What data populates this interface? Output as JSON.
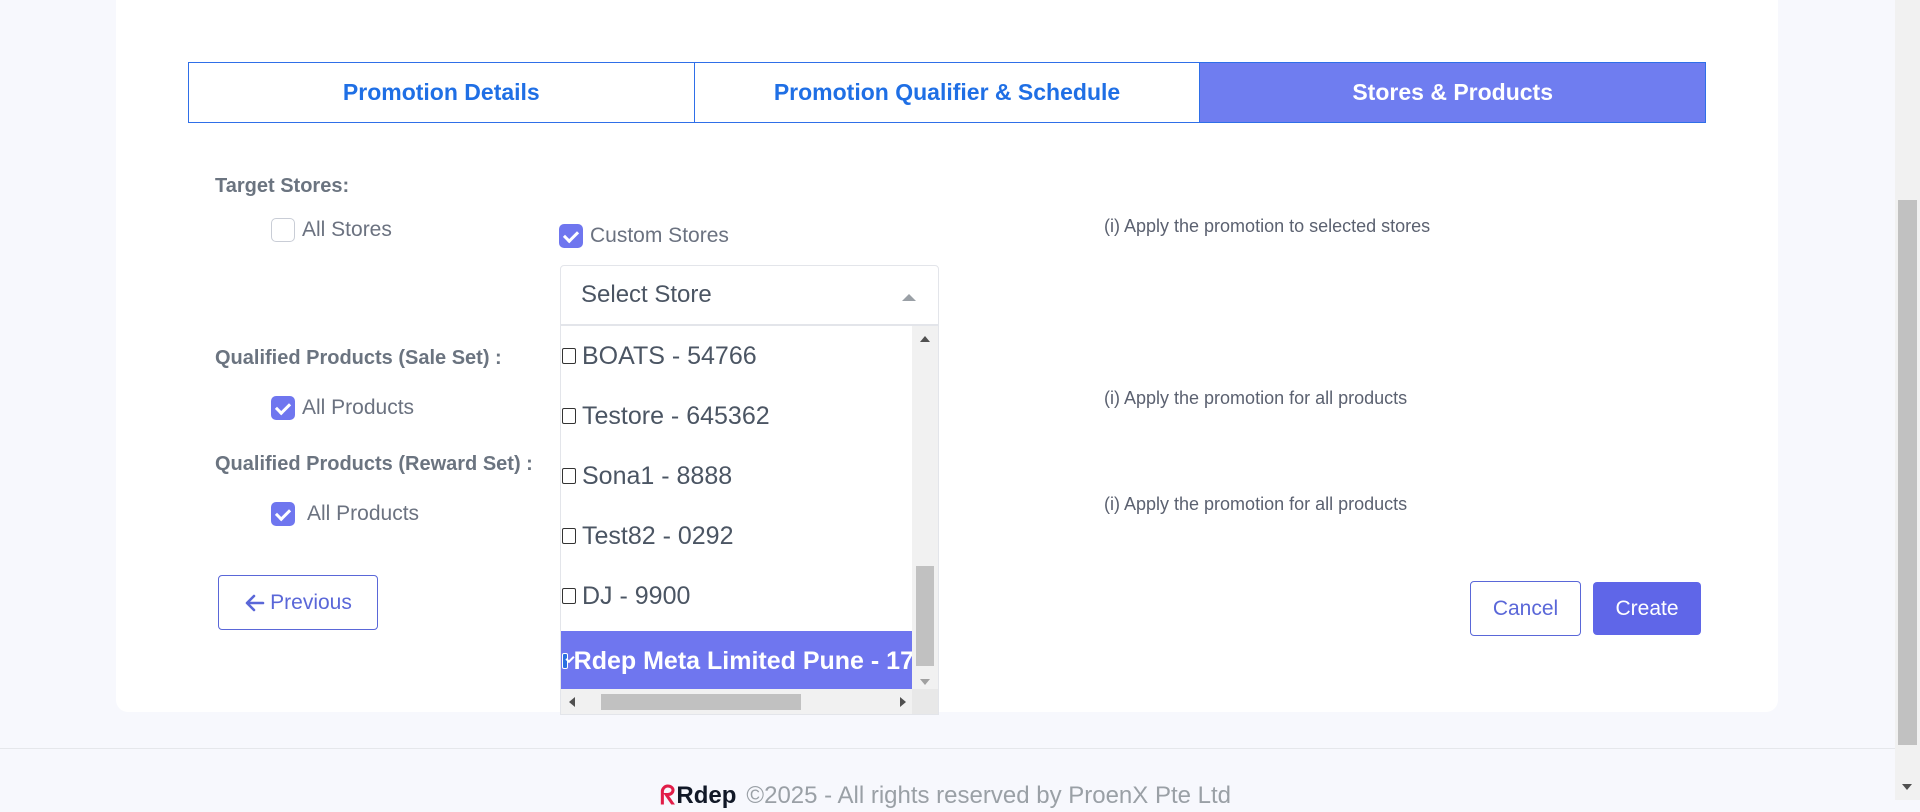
{
  "tabs": [
    {
      "label": "Promotion Details",
      "active": false
    },
    {
      "label": "Promotion Qualifier & Schedule",
      "active": false
    },
    {
      "label": "Stores & Products",
      "active": true
    }
  ],
  "target_stores": {
    "label": "Target Stores:",
    "all_stores": {
      "label": "All Stores",
      "checked": false
    },
    "custom_stores": {
      "label": "Custom Stores",
      "checked": true
    },
    "hint": "(i) Apply the promotion to selected stores"
  },
  "store_select": {
    "placeholder": "Select Store",
    "options": [
      {
        "label": "BOATS - 54766",
        "checked": false
      },
      {
        "label": "Testore - 645362",
        "checked": false
      },
      {
        "label": "Sona1 - 8888",
        "checked": false
      },
      {
        "label": "Test82 - 0292",
        "checked": false
      },
      {
        "label": "DJ - 9900",
        "checked": false
      },
      {
        "label": "Rdep Meta Limited Pune - 17",
        "checked": true
      }
    ]
  },
  "sale_set": {
    "label": "Qualified Products (Sale Set) :",
    "all_products": {
      "label": "All Products",
      "checked": true
    },
    "hint": "(i) Apply the promotion for all products"
  },
  "reward_set": {
    "label": "Qualified Products (Reward Set) :",
    "all_products": {
      "label": "All Products",
      "checked": true
    },
    "hint": "(i) Apply the promotion for all products"
  },
  "buttons": {
    "previous": "Previous",
    "cancel": "Cancel",
    "create": "Create"
  },
  "footer": {
    "logo": "Rdep",
    "text": "©2025 - All rights reserved by ProenX Pte Ltd"
  },
  "colors": {
    "accent": "#6f76ef",
    "tab_border": "#2f6fe8",
    "tab_text": "#1f6fe5"
  }
}
